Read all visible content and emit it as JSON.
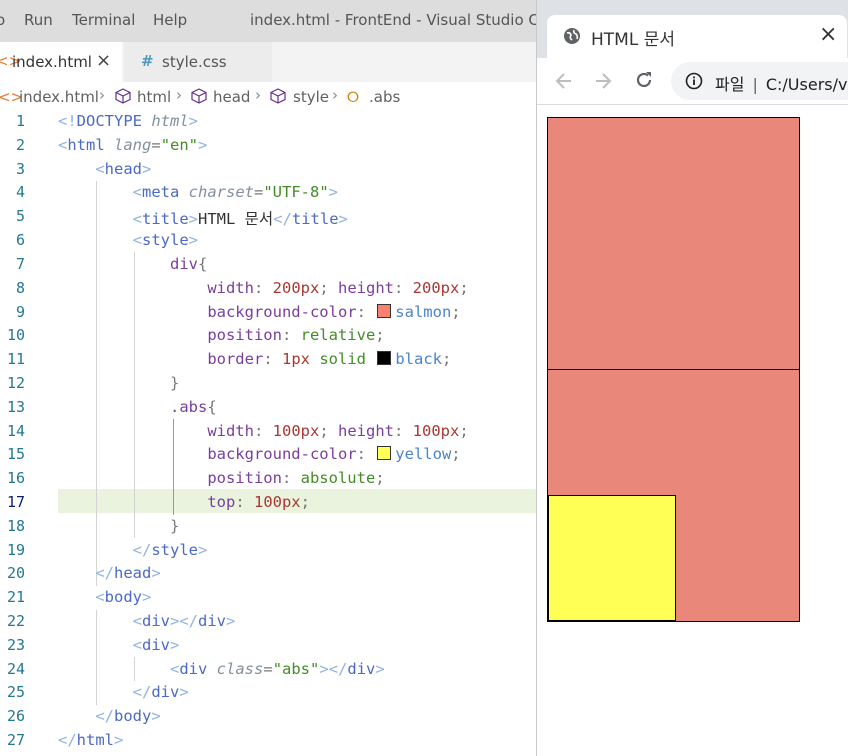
{
  "vscode": {
    "menu": [
      "o",
      "Run",
      "Terminal",
      "Help"
    ],
    "window_title": "index.html - FrontEnd - Visual Studio Code",
    "tabs": [
      {
        "icon": "html-file-icon",
        "label": "index.html",
        "close": "×"
      },
      {
        "icon": "css-hash-icon",
        "label": "style.css"
      }
    ],
    "breadcrumb": [
      "index.html",
      "html",
      "head",
      "style",
      ".abs"
    ],
    "line_numbers": [
      "1",
      "2",
      "3",
      "4",
      "5",
      "6",
      "7",
      "8",
      "9",
      "10",
      "11",
      "12",
      "13",
      "14",
      "15",
      "16",
      "17",
      "18",
      "19",
      "20",
      "21",
      "22",
      "23",
      "24",
      "25",
      "26",
      "27"
    ],
    "swatch_colors": {
      "salmon": "#fa8072",
      "black": "#000000",
      "yellow": "#ffff00"
    }
  },
  "browser": {
    "tab_title": "HTML 문서",
    "tab_close": "×",
    "omnibox_label": "파일",
    "omnibox_url": "C:/Users/v",
    "render": {
      "div_color": "#e9887a",
      "abs_color": "#ffff55",
      "border_color": "#000000"
    }
  }
}
